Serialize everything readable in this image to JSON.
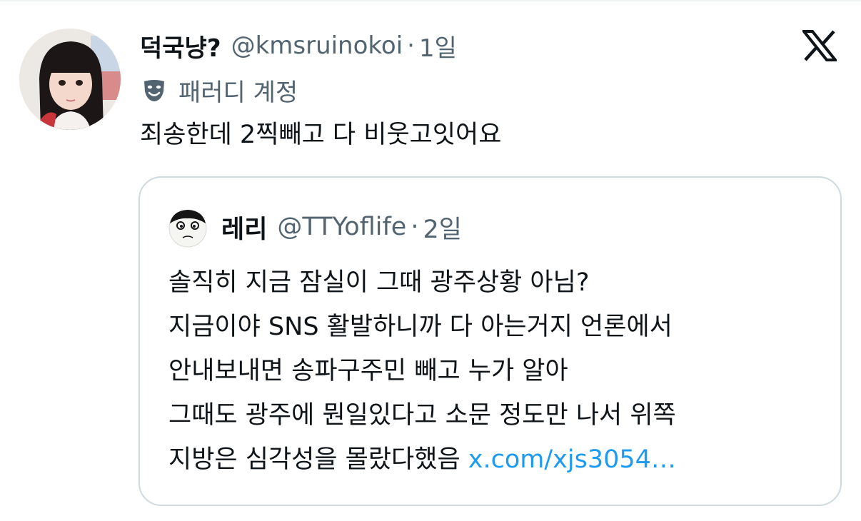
{
  "tweet": {
    "author": {
      "display_name": "덕국냥?",
      "handle": "@kmsruinokoi",
      "avatar_icon": "profile-photo"
    },
    "separator": "·",
    "time": "1일",
    "parody_icon": "theater-mask-icon",
    "parody_label": "패러디 계정",
    "text": "죄송한데 2찍빼고 다 비웃고잇어요",
    "platform_icon": "x-logo-icon"
  },
  "quote": {
    "author": {
      "display_name": "레리",
      "handle": "@TTYoflife",
      "avatar_icon": "cartoon-face-avatar"
    },
    "separator": "·",
    "time": "2일",
    "lines": [
      "솔직히 지금 잠실이 그때 광주상황 아님?",
      "지금이야 SNS 활발하니까 다 아는거지 언론에서",
      "안내보내면 송파구주민 빼고 누가 알아",
      "그때도 광주에 뭔일있다고 소문 정도만 나서 위쪽",
      "지방은 심각성을 몰랐다했음 "
    ],
    "link_text": "x.com/xjs3054…"
  },
  "colors": {
    "text_primary": "#0f1419",
    "text_secondary": "#536471",
    "link": "#1d9bf0",
    "border": "#cfd9de"
  }
}
